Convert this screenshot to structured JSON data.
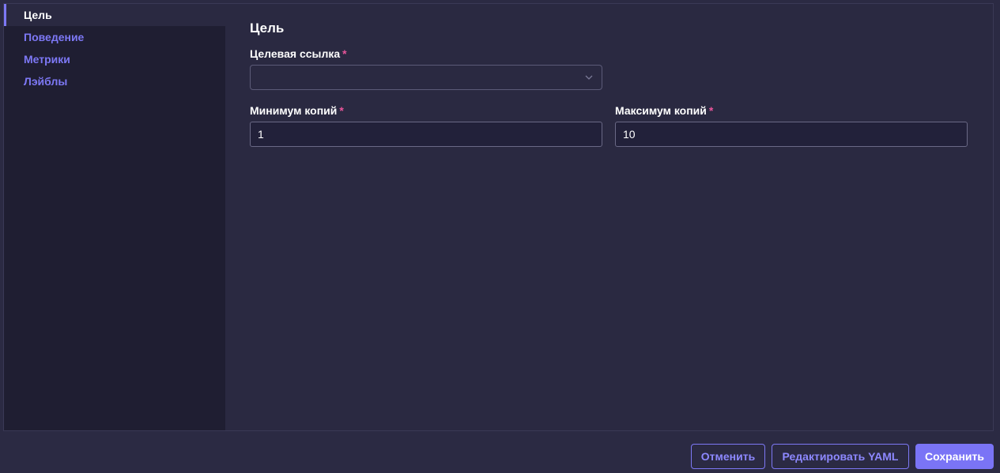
{
  "sidebar": {
    "items": [
      {
        "label": "Цель",
        "active": true
      },
      {
        "label": "Поведение",
        "active": false
      },
      {
        "label": "Метрики",
        "active": false
      },
      {
        "label": "Лэйблы",
        "active": false
      }
    ]
  },
  "main": {
    "title": "Цель",
    "target_link": {
      "label": "Целевая ссылка",
      "required_mark": "*",
      "value": ""
    },
    "min_replicas": {
      "label": "Минимум копий",
      "required_mark": "*",
      "value": "1"
    },
    "max_replicas": {
      "label": "Максимум копий",
      "required_mark": "*",
      "value": "10"
    }
  },
  "footer": {
    "cancel_label": "Отменить",
    "edit_yaml_label": "Редактировать YAML",
    "save_label": "Сохранить"
  },
  "colors": {
    "accent": "#7d78f5",
    "required": "#e8559a",
    "background": "#2b2a43",
    "sidebar": "#1f1e32"
  }
}
